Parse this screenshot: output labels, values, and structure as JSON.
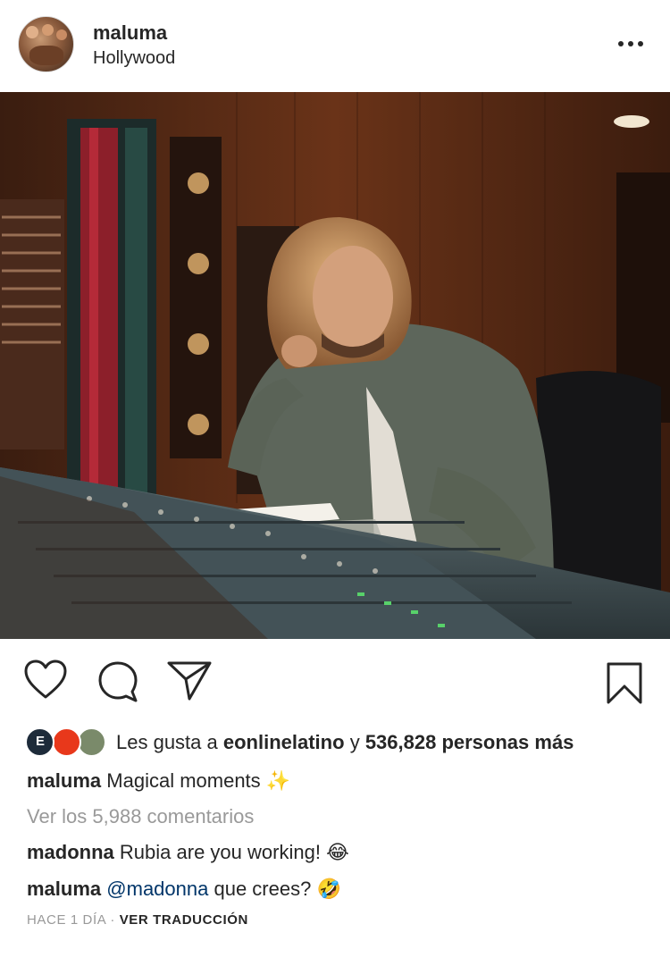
{
  "post": {
    "username": "maluma",
    "location": "Hollywood",
    "more_icon": "more-dots-icon"
  },
  "actions": {
    "like_icon": "heart-icon",
    "comment_icon": "comment-icon",
    "share_icon": "send-icon",
    "save_icon": "bookmark-icon"
  },
  "likes": {
    "prefix": "Les gusta a",
    "first_liker": "eonlinelatino",
    "connector": "y",
    "count_text": "536,828 personas más",
    "liker_colors": [
      "#1d2b3a",
      "#e8381b",
      "#7a8a6a"
    ]
  },
  "caption": {
    "username": "maluma",
    "text": "Magical moments",
    "emoji": "✨"
  },
  "comments": {
    "view_all": "Ver los 5,988 comentarios",
    "items": [
      {
        "username": "madonna",
        "text": "Rubia are you working!",
        "emoji": "😂"
      },
      {
        "username": "maluma",
        "mention": "@madonna",
        "text": "que crees?",
        "emoji": "🤣"
      }
    ]
  },
  "meta": {
    "time": "HACE 1 DÍA",
    "separator": "·",
    "translate": "VER TRADUCCIÓN"
  },
  "colors": {
    "text": "#262626",
    "secondary": "#999999",
    "link": "#003569"
  }
}
